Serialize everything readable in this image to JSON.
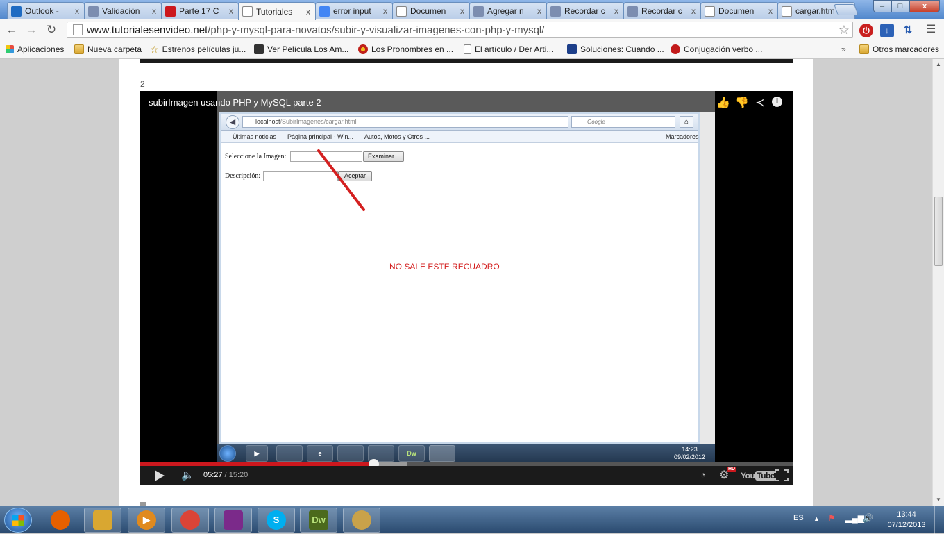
{
  "tabs": [
    {
      "label": "Outlook -",
      "icon": "outlook-icon",
      "color": "#1f6bc2"
    },
    {
      "label": "Validación",
      "icon": "generic-page-icon",
      "color": "#7c8db0"
    },
    {
      "label": "Parte 17 C",
      "icon": "youtube-icon",
      "color": "#cc181e"
    },
    {
      "label": "Tutoriales",
      "icon": "document-icon",
      "color": "#ffffff",
      "active": true
    },
    {
      "label": "error input",
      "icon": "google-icon",
      "color": "#4285f4"
    },
    {
      "label": "Documen",
      "icon": "document-icon",
      "color": "#ffffff"
    },
    {
      "label": "Agregar n",
      "icon": "generic-page-icon",
      "color": "#7c8db0"
    },
    {
      "label": "Recordar c",
      "icon": "generic-page-icon",
      "color": "#7c8db0"
    },
    {
      "label": "Recordar c",
      "icon": "generic-page-icon",
      "color": "#7c8db0"
    },
    {
      "label": "Documen",
      "icon": "document-icon",
      "color": "#ffffff"
    },
    {
      "label": "cargar.htm",
      "icon": "document-icon",
      "color": "#ffffff"
    }
  ],
  "tab_close_glyph": "x",
  "window_controls": {
    "minimize": "–",
    "maximize": "□",
    "close": "x"
  },
  "address_bar": {
    "host": "www.tutorialesenvideo.net",
    "path": "/php-y-mysql-para-novatos/subir-y-visualizar-imagenes-con-php-y-mysql/"
  },
  "bookmarks": [
    {
      "label": "Aplicaciones",
      "icon": "apps-grid-icon"
    },
    {
      "label": "Nueva carpeta",
      "icon": "folder-icon"
    },
    {
      "label": "Estrenos películas ju...",
      "icon": "star-icon"
    },
    {
      "label": "Ver Película Los Am...",
      "icon": "clapperboard-icon"
    },
    {
      "label": "Los Pronombres en ...",
      "icon": "globe-icon"
    },
    {
      "label": "El artículo / Der Arti...",
      "icon": "document-icon"
    },
    {
      "label": "Soluciones: Cuando ...",
      "icon": "ca-icon"
    },
    {
      "label": "Conjugación verbo ...",
      "icon": "flame-icon"
    }
  ],
  "bookmarks_overflow": "»",
  "other_bookmarks": "Otros marcadores",
  "page": {
    "item_number": "2"
  },
  "video": {
    "title": "subirImagen usando PHP y MySQL parte 2",
    "time_current": "05:27",
    "time_total": "/ 15:20",
    "progress_fraction": 0.357,
    "buffer_fraction": 0.41,
    "hd_label": "HD",
    "logo": {
      "you": "You",
      "tube": "Tube"
    }
  },
  "recorded_screen": {
    "url_host": "localhost",
    "url_path": "/SubirImagenes/cargar.html",
    "search_placeholder": "Google",
    "bookmarks": [
      "Últimas noticias",
      "Página principal - Win...",
      "Autos, Motos y Otros ...",
      "Marcadores"
    ],
    "form": {
      "image_label": "Seleccione la Imagen:",
      "browse_button": "Examinar...",
      "description_label": "Descripción:",
      "submit_button": "Aceptar"
    },
    "annotation": "NO SALE ESTE RECUADRO",
    "taskbar_dw": "Dw",
    "clock_time": "14:23",
    "clock_date": "09/02/2012"
  },
  "taskbar": {
    "language": "ES",
    "time": "13:44",
    "date": "07/12/2013",
    "apps": [
      {
        "name": "firefox-icon",
        "glyph": "",
        "color": "#e66000"
      },
      {
        "name": "file-explorer-icon",
        "glyph": "",
        "color": "#d9a731"
      },
      {
        "name": "media-player-icon",
        "glyph": "▶",
        "color": "#e08a1e"
      },
      {
        "name": "chrome-icon",
        "glyph": "",
        "color": "#db4437"
      },
      {
        "name": "winrar-icon",
        "glyph": "",
        "color": "#7b2a8a"
      },
      {
        "name": "skype-icon",
        "glyph": "S",
        "color": "#00aff0"
      },
      {
        "name": "dreamweaver-icon",
        "glyph": "Dw",
        "color": "#4b6a1c"
      },
      {
        "name": "paint-icon",
        "glyph": "",
        "color": "#c9a24a"
      }
    ]
  }
}
